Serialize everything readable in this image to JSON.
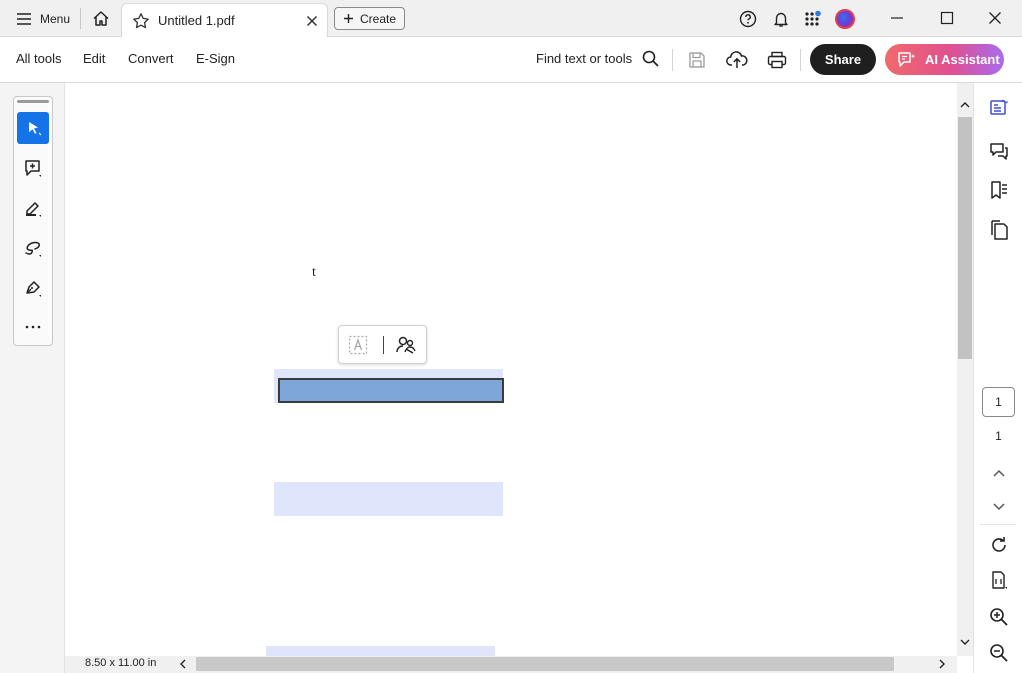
{
  "titlebar": {
    "menu_label": "Menu",
    "tab_title": "Untitled 1.pdf",
    "create_label": "Create"
  },
  "toolbar": {
    "tabs": [
      "All tools",
      "Edit",
      "Convert",
      "E-Sign"
    ],
    "find_label": "Find text or tools",
    "share_label": "Share",
    "ai_label": "AI Assistant"
  },
  "document": {
    "text_t": "t"
  },
  "statusbar": {
    "page_size": "8.50 x 11.00 in"
  },
  "pagenav": {
    "current_page": "1",
    "total_pages": "1"
  },
  "colors": {
    "accent": "#1473e6",
    "field_highlight": "#dfe6fb",
    "field_selected": "#7fa6d8"
  }
}
